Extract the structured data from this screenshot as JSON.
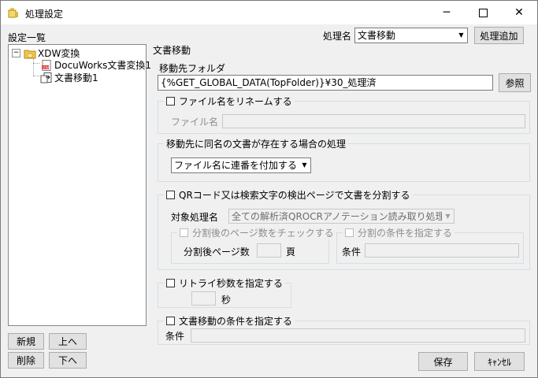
{
  "window": {
    "title": "処理設定",
    "minimize": "─",
    "maximize": "☐",
    "close": "✕"
  },
  "left": {
    "list_title": "設定一覧",
    "tree": [
      {
        "label": "XDW変換",
        "icon": "folder-icon",
        "expander": "⊟"
      },
      {
        "label": "DocuWorks文書変換1",
        "icon": "docuworks-icon"
      },
      {
        "label": "文書移動1",
        "icon": "document-move-icon"
      }
    ],
    "buttons": {
      "new": "新規",
      "up": "上へ",
      "delete": "削除",
      "down": "下へ"
    }
  },
  "header": {
    "process_name_label": "処理名",
    "process_name_value": "文書移動",
    "add_process": "処理追加"
  },
  "main": {
    "section_title": "文書移動",
    "dest_folder_label": "移動先フォルダ",
    "dest_folder_value": "{%GET_GLOBAL_DATA(TopFolder)}¥30_処理済",
    "browse": "参照",
    "rename": {
      "checkbox_label": "ファイル名をリネームする",
      "file_name_label": "ファイル名",
      "file_name_value": ""
    },
    "duplicate": {
      "legend": "移動先に同名の文書が存在する場合の処理",
      "selected": "ファイル名に連番を付加する"
    },
    "split": {
      "checkbox_label": "QRコード又は検索文字の検出ページで文書を分割する",
      "target_label": "対象処理名",
      "target_value": "全ての解析済QROCRアノテーション読み取り処理",
      "page_count_check": "分割後のページ数をチェックする",
      "page_count_label": "分割後ページ数",
      "page_count_value": "",
      "page_unit": "頁",
      "condition_check": "分割の条件を指定する",
      "condition_label": "条件",
      "condition_value": ""
    },
    "retry": {
      "checkbox_label": "リトライ秒数を指定する",
      "seconds_value": "",
      "seconds_unit": "秒"
    },
    "move_condition": {
      "checkbox_label": "文書移動の条件を指定する",
      "condition_label": "条件",
      "condition_value": ""
    }
  },
  "footer": {
    "save": "保存",
    "cancel": "ｷｬﾝｾﾙ"
  }
}
